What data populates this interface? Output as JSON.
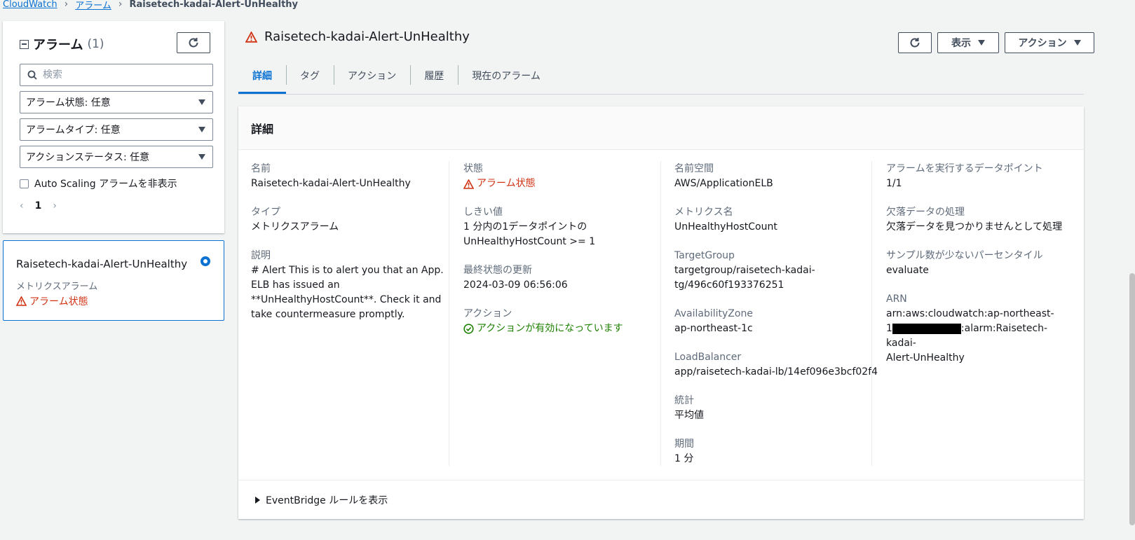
{
  "breadcrumb": {
    "root": "CloudWatch",
    "alarms": "アラーム",
    "current": "Raisetech-kadai-Alert-UnHealthy"
  },
  "left_panel": {
    "title": "アラーム",
    "count": "(1)",
    "search_placeholder": "検索",
    "filters": {
      "state": "アラーム状態: 任意",
      "type": "アラームタイプ: 任意",
      "action_status": "アクションステータス: 任意"
    },
    "hide_autoscaling_label": "Auto Scaling アラームを非表示",
    "page": "1"
  },
  "alarm_card": {
    "name": "Raisetech-kadai-Alert-UnHealthy",
    "type": "メトリクスアラーム",
    "state": "アラーム状態"
  },
  "header": {
    "title": "Raisetech-kadai-Alert-UnHealthy",
    "view_label": "表示",
    "actions_label": "アクション"
  },
  "tabs": [
    "詳細",
    "タグ",
    "アクション",
    "履歴",
    "現在のアラーム"
  ],
  "details": {
    "heading": "詳細",
    "col1": {
      "name_label": "名前",
      "name_value": "Raisetech-kadai-Alert-UnHealthy",
      "type_label": "タイプ",
      "type_value": "メトリクスアラーム",
      "desc_label": "説明",
      "desc_lines": [
        "# Alert This is to alert you that an App.",
        "ELB has issued an",
        "**UnHealthyHostCount**. Check it and",
        "take countermeasure promptly."
      ]
    },
    "col2": {
      "state_label": "状態",
      "state_value": "アラーム状態",
      "threshold_label": "しきい値",
      "threshold_line1": "1 分内の1データポイントの",
      "threshold_line2": "UnHealthyHostCount >= 1",
      "updated_label": "最終状態の更新",
      "updated_value": "2024-03-09 06:56:06",
      "action_label": "アクション",
      "action_value": "アクションが有効になっています"
    },
    "col3": {
      "namespace_label": "名前空間",
      "namespace_value": "AWS/ApplicationELB",
      "metric_label": "メトリクス名",
      "metric_value": "UnHealthyHostCount",
      "tg_label": "TargetGroup",
      "tg_line1": "targetgroup/raisetech-kadai-",
      "tg_line2": "tg/496c60f193376251",
      "az_label": "AvailabilityZone",
      "az_value": "ap-northeast-1c",
      "lb_label": "LoadBalancer",
      "lb_value": "app/raisetech-kadai-lb/14ef096e3bcf02f4",
      "stat_label": "統計",
      "stat_value": "平均値",
      "period_label": "期間",
      "period_value": "1 分"
    },
    "col4": {
      "dp_label": "アラームを実行するデータポイント",
      "dp_value": "1/1",
      "missing_label": "欠落データの処理",
      "missing_value": "欠落データを見つかりませんとして処理",
      "percentile_label": "サンプル数が少ないパーセンタイル",
      "percentile_value": "evaluate",
      "arn_label": "ARN",
      "arn_line1": "arn:aws:cloudwatch:ap-northeast-",
      "arn_line2_prefix": "1",
      "arn_line2_suffix": ":alarm:Raisetech-kadai-",
      "arn_line3": "Alert-UnHealthy"
    },
    "eventbridge_label": "EventBridge ルールを表示"
  },
  "colors": {
    "accent": "#0972d3",
    "alarm_red": "#d13212",
    "ok_green": "#1d8102"
  }
}
